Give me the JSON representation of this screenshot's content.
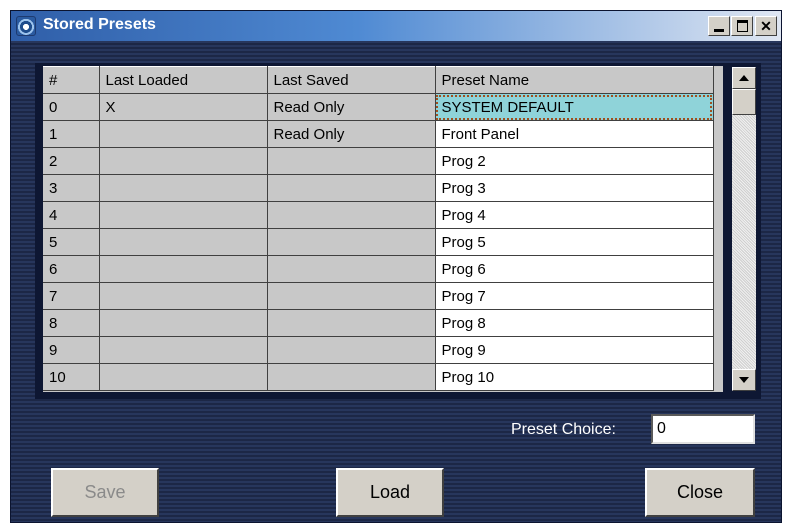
{
  "window": {
    "title": "Stored Presets"
  },
  "grid": {
    "columns": [
      "#",
      "Last Loaded",
      "Last Saved",
      "Preset Name"
    ],
    "rows": [
      [
        "0",
        "X",
        "Read Only",
        "SYSTEM DEFAULT"
      ],
      [
        "1",
        "",
        "Read Only",
        "Front Panel"
      ],
      [
        "2",
        "",
        "",
        "Prog 2"
      ],
      [
        "3",
        "",
        "",
        "Prog 3"
      ],
      [
        "4",
        "",
        "",
        "Prog 4"
      ],
      [
        "5",
        "",
        "",
        "Prog 5"
      ],
      [
        "6",
        "",
        "",
        "Prog 6"
      ],
      [
        "7",
        "",
        "",
        "Prog 7"
      ],
      [
        "8",
        "",
        "",
        "Prog 8"
      ],
      [
        "9",
        "",
        "",
        "Prog 9"
      ],
      [
        "10",
        "",
        "",
        "Prog 10"
      ]
    ],
    "selected_row": 0
  },
  "preset_choice": {
    "label": "Preset Choice:",
    "value": "0"
  },
  "buttons": {
    "save": "Save",
    "load": "Load",
    "close": "Close"
  },
  "icons": {
    "minimize": "minimize-icon",
    "maximize": "maximize-icon",
    "close": "close-icon",
    "app": "app-icon"
  },
  "colors": {
    "selection": "#8fd3d9",
    "title_gradient_start": "#2f5ea8"
  }
}
